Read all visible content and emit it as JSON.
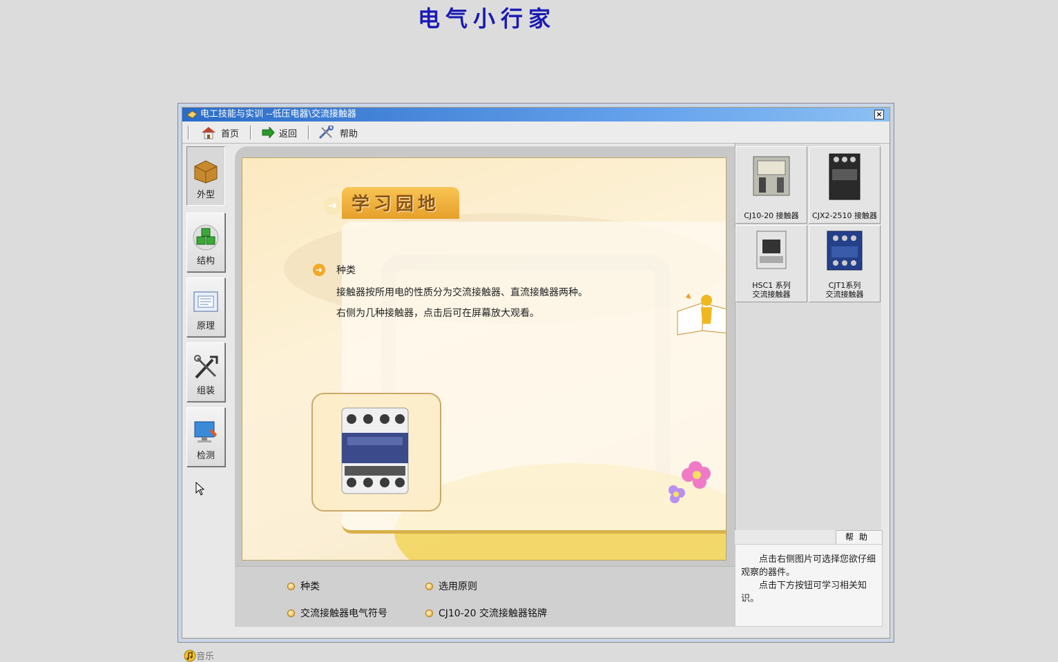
{
  "banner": "电气小行家",
  "window": {
    "title": "电工技能与实训 --低压电器\\交流接触器",
    "close": "×"
  },
  "toolbar": {
    "home": "首页",
    "back": "返回",
    "help": "帮助"
  },
  "nav": [
    {
      "label": "外型",
      "icon": "box-icon"
    },
    {
      "label": "结构",
      "icon": "cubes-icon"
    },
    {
      "label": "原理",
      "icon": "diagram-icon"
    },
    {
      "label": "组装",
      "icon": "tools-icon"
    },
    {
      "label": "检测",
      "icon": "monitor-icon"
    }
  ],
  "music": "音乐",
  "content": {
    "header": "学习园地",
    "section_title": "种类",
    "para1": "接触器按所用电的性质分为交流接触器、直流接触器两种。",
    "para2": "右侧为几种接触器，点击后可在屏幕放大观看。"
  },
  "links": {
    "types": "种类",
    "selection": "选用原则",
    "symbol": "交流接触器电气符号",
    "nameplate": "CJ10-20 交流接触器铭牌"
  },
  "tiles": [
    {
      "line1": "CJ10-20 接触器",
      "line2": ""
    },
    {
      "line1": "CJX2-2510 接触器",
      "line2": ""
    },
    {
      "line1": "HSC1 系列",
      "line2": "交流接触器"
    },
    {
      "line1": "CJT1系列",
      "line2": "交流接触器"
    }
  ],
  "help": {
    "tab": "帮助",
    "text1": "点击右侧图片可选择您欲仔细观察的器件。",
    "text2": "点击下方按钮可学习相关知识。"
  }
}
